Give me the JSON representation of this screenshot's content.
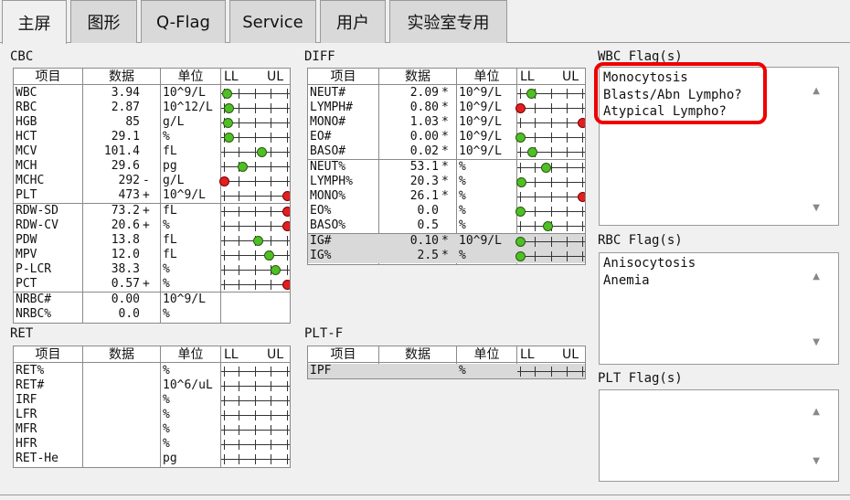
{
  "tabs": [
    "主屏",
    "图形",
    "Q-Flag",
    "Service",
    "用户",
    "实验室专用"
  ],
  "headers": {
    "item": "项目",
    "data": "数据",
    "unit": "单位",
    "ll": "LL",
    "ul": "UL"
  },
  "colors": {
    "normal_marker": "#4fbf26",
    "abnormal_marker": "#e02020",
    "flag_highlight": "#ee0000"
  },
  "cbc": {
    "title": "CBC",
    "rows": [
      {
        "name": "WBC",
        "value": "3.94",
        "flag": "",
        "unit": "10^9/L",
        "marker": 0.05,
        "color": "green"
      },
      {
        "name": "RBC",
        "value": "2.87",
        "flag": "",
        "unit": "10^12/L",
        "marker": 0.08,
        "color": "green"
      },
      {
        "name": "HGB",
        "value": "85",
        "flag": "",
        "unit": "g/L",
        "marker": 0.06,
        "color": "green"
      },
      {
        "name": "HCT",
        "value": "29.1",
        "flag": "",
        "unit": "%",
        "marker": 0.08,
        "color": "green"
      },
      {
        "name": "MCV",
        "value": "101.4",
        "flag": "",
        "unit": "fL",
        "marker": 0.6,
        "color": "green"
      },
      {
        "name": "MCH",
        "value": "29.6",
        "flag": "",
        "unit": "pg",
        "marker": 0.3,
        "color": "green"
      },
      {
        "name": "MCHC",
        "value": "292",
        "flag": "-",
        "unit": "g/L",
        "marker": 0.0,
        "color": "red"
      },
      {
        "name": "PLT",
        "value": "473",
        "flag": "+",
        "unit": "10^9/L",
        "marker": 1.0,
        "color": "red"
      },
      {
        "name": "RDW-SD",
        "value": "73.2",
        "flag": "+",
        "unit": "fL",
        "marker": 1.0,
        "color": "red"
      },
      {
        "name": "RDW-CV",
        "value": "20.6",
        "flag": "+",
        "unit": "%",
        "marker": 1.0,
        "color": "red"
      },
      {
        "name": "PDW",
        "value": "13.8",
        "flag": "",
        "unit": "fL",
        "marker": 0.55,
        "color": "green"
      },
      {
        "name": "MPV",
        "value": "12.0",
        "flag": "",
        "unit": "fL",
        "marker": 0.72,
        "color": "green"
      },
      {
        "name": "P-LCR",
        "value": "38.3",
        "flag": "",
        "unit": "%",
        "marker": 0.82,
        "color": "green"
      },
      {
        "name": "PCT",
        "value": "0.57",
        "flag": "+",
        "unit": "%",
        "marker": 1.0,
        "color": "red"
      },
      {
        "name": "NRBC#",
        "value": "0.00",
        "flag": "",
        "unit": "10^9/L",
        "marker": null,
        "color": ""
      },
      {
        "name": "NRBC%",
        "value": "0.0",
        "flag": "",
        "unit": "%",
        "marker": null,
        "color": ""
      }
    ]
  },
  "diff": {
    "title": "DIFF",
    "rows": [
      {
        "name": "NEUT#",
        "value": "2.09",
        "flag": "*",
        "unit": "10^9/L",
        "marker": 0.18,
        "color": "green"
      },
      {
        "name": "LYMPH#",
        "value": "0.80",
        "flag": "*",
        "unit": "10^9/L",
        "marker": 0.0,
        "color": "red"
      },
      {
        "name": "MONO#",
        "value": "1.03",
        "flag": "*",
        "unit": "10^9/L",
        "marker": 1.0,
        "color": "red"
      },
      {
        "name": "EO#",
        "value": "0.00",
        "flag": "*",
        "unit": "10^9/L",
        "marker": 0.0,
        "color": "green"
      },
      {
        "name": "BASO#",
        "value": "0.02",
        "flag": "*",
        "unit": "10^9/L",
        "marker": 0.2,
        "color": "green"
      },
      {
        "name": "NEUT%",
        "value": "53.1",
        "flag": "*",
        "unit": "%",
        "marker": 0.42,
        "color": "green"
      },
      {
        "name": "LYMPH%",
        "value": "20.3",
        "flag": "*",
        "unit": "%",
        "marker": 0.02,
        "color": "green"
      },
      {
        "name": "MONO%",
        "value": "26.1",
        "flag": "*",
        "unit": "%",
        "marker": 1.0,
        "color": "red"
      },
      {
        "name": "EO%",
        "value": "0.0",
        "flag": "",
        "unit": "%",
        "marker": 0.0,
        "color": "green"
      },
      {
        "name": "BASO%",
        "value": "0.5",
        "flag": "",
        "unit": "%",
        "marker": 0.45,
        "color": "green"
      },
      {
        "name": "IG#",
        "value": "0.10",
        "flag": "*",
        "unit": "10^9/L",
        "marker": 0.0,
        "color": "green"
      },
      {
        "name": "IG%",
        "value": "2.5",
        "flag": "*",
        "unit": "%",
        "marker": 0.0,
        "color": "green"
      }
    ]
  },
  "ret": {
    "title": "RET",
    "rows": [
      {
        "name": "RET%",
        "value": "",
        "flag": "",
        "unit": "%"
      },
      {
        "name": "RET#",
        "value": "",
        "flag": "",
        "unit": "10^6/uL"
      },
      {
        "name": "IRF",
        "value": "",
        "flag": "",
        "unit": "%"
      },
      {
        "name": "LFR",
        "value": "",
        "flag": "",
        "unit": "%"
      },
      {
        "name": "MFR",
        "value": "",
        "flag": "",
        "unit": "%"
      },
      {
        "name": "HFR",
        "value": "",
        "flag": "",
        "unit": "%"
      },
      {
        "name": "RET-He",
        "value": "",
        "flag": "",
        "unit": "pg"
      }
    ]
  },
  "pltf": {
    "title": "PLT-F",
    "rows": [
      {
        "name": "IPF",
        "value": "",
        "flag": "",
        "unit": "%"
      }
    ]
  },
  "wbc_flags": {
    "title": "WBC Flag(s)",
    "items": [
      "Monocytosis",
      "Blasts/Abn Lympho?",
      "Atypical Lympho?"
    ]
  },
  "rbc_flags": {
    "title": "RBC Flag(s)",
    "items": [
      "Anisocytosis",
      "Anemia"
    ]
  },
  "plt_flags": {
    "title": "PLT Flag(s)",
    "items": []
  }
}
